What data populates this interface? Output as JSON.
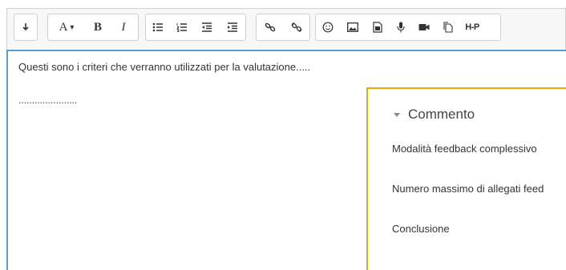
{
  "toolbar": {
    "undo_icon": "arrow-down-icon",
    "font_label": "A",
    "font_caret": "▾",
    "bold_label": "B",
    "italic_label": "I",
    "hp_label": "H-P"
  },
  "editor": {
    "line1": "Questi sono i criteri che verranno utilizzati per la valutazione.....",
    "line2": "......................"
  },
  "panel": {
    "title": "Commento",
    "items": [
      "Modalità feedback complessivo",
      "Numero massimo di allegati feed",
      "Conclusione"
    ]
  },
  "colors": {
    "editor_border": "#5b9bd5",
    "panel_accent": "#f0a30a"
  }
}
